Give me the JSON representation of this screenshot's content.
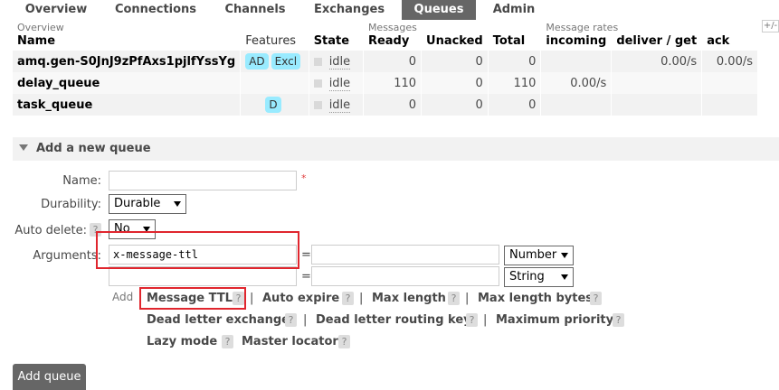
{
  "nav": {
    "tabs": [
      {
        "label": "Overview"
      },
      {
        "label": "Connections"
      },
      {
        "label": "Channels"
      },
      {
        "label": "Exchanges"
      },
      {
        "label": "Queues"
      },
      {
        "label": "Admin"
      }
    ],
    "active": "Queues"
  },
  "table": {
    "groups": {
      "overview": "Overview",
      "messages": "Messages",
      "rates": "Message rates"
    },
    "plus": "+/-",
    "columns": [
      "Name",
      "Features",
      "State",
      "Ready",
      "Unacked",
      "Total",
      "incoming",
      "deliver / get",
      "ack"
    ],
    "rows": [
      {
        "name": "amq.gen-S0JnJ9zPfAxs1pjlfYssYg",
        "features": [
          "AD",
          "Excl"
        ],
        "state": "idle",
        "ready": "0",
        "unacked": "0",
        "total": "0",
        "incoming": "",
        "deliver": "0.00/s",
        "ack": "0.00/s"
      },
      {
        "name": "delay_queue",
        "features": [],
        "state": "idle",
        "ready": "110",
        "unacked": "0",
        "total": "110",
        "incoming": "0.00/s",
        "deliver": "",
        "ack": ""
      },
      {
        "name": "task_queue",
        "features": [
          "D"
        ],
        "state": "idle",
        "ready": "0",
        "unacked": "0",
        "total": "0",
        "incoming": "",
        "deliver": "",
        "ack": ""
      }
    ]
  },
  "add_queue": {
    "title": "Add a new queue",
    "name_label": "Name:",
    "name_value": "",
    "required_mark": "*",
    "durability_label": "Durability:",
    "durability_value": "Durable",
    "auto_delete_label": "Auto delete:",
    "auto_delete_help": "?",
    "auto_delete_value": "No",
    "arguments_label": "Arguments:",
    "arguments": [
      {
        "key": "x-message-ttl",
        "eq": "=",
        "value": "",
        "type": "Number"
      },
      {
        "key": "",
        "eq": "=",
        "value": "",
        "type": "String"
      }
    ],
    "add_word": "Add",
    "arg_links": [
      "Message TTL",
      "Auto expire",
      "Max length",
      "Max length bytes",
      "Dead letter exchange",
      "Dead letter routing key",
      "Maximum priority",
      "Lazy mode",
      "Master locator"
    ],
    "help_glyph": "?",
    "separator": "|",
    "submit_label": "Add queue"
  },
  "colors": {
    "active_tab": "#666666",
    "badge": "#99ebff",
    "highlight": "#e0262e",
    "row_bg": "#f2f2f2"
  },
  "icons": {
    "section_toggle": "triangle-down-icon",
    "select_arrow": "chevron-down-icon",
    "help": "question-icon"
  }
}
